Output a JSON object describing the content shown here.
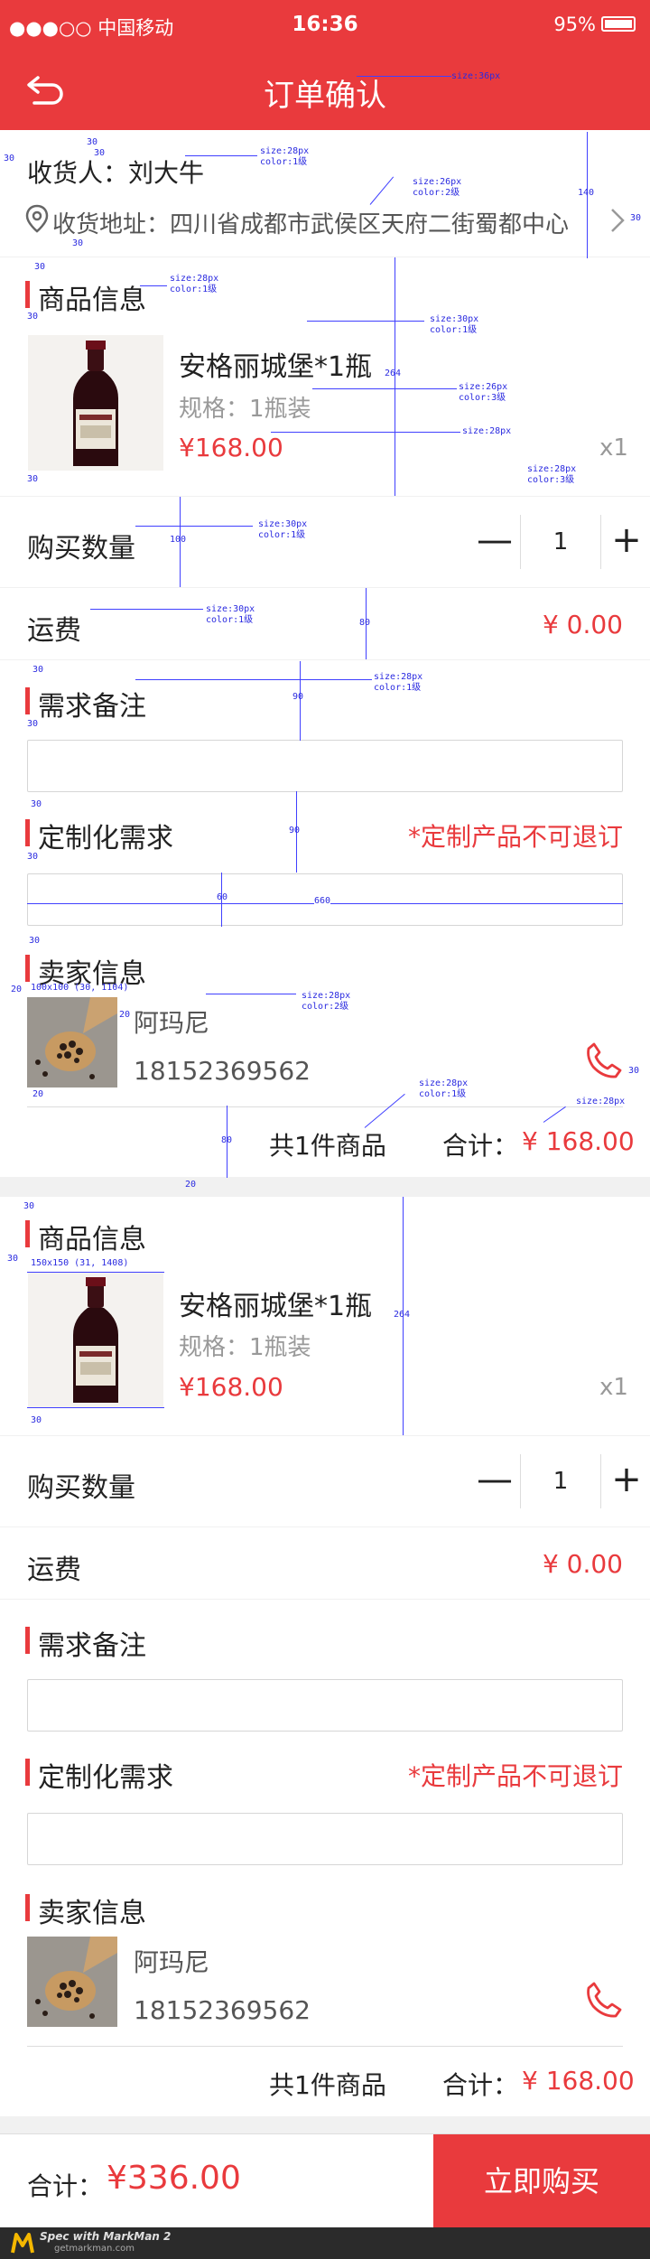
{
  "status": {
    "carrier": "●●●○○ 中国移动",
    "time": "16:36",
    "battery": "95%"
  },
  "nav": {
    "title": "订单确认"
  },
  "address": {
    "receiver": "收货人：刘大牛",
    "address": "收货地址：四川省成都市武侯区天府二街蜀都中心"
  },
  "order_blocks": [
    {
      "section_product": "商品信息",
      "product_name": "安格丽城堡*1瓶",
      "spec": "规格：1瓶装",
      "price": "¥168.00",
      "qty_label": "x1",
      "buy_count_label": "购买数量",
      "buy_count_value": "1",
      "minus": "—",
      "plus": "+",
      "shipping_label": "运费",
      "shipping_value": "¥ 0.00",
      "remark_title": "需求备注",
      "custom_title": "定制化需求",
      "custom_note": "*定制产品不可退订",
      "seller_title": "卖家信息",
      "seller_name": "阿玛尼",
      "seller_phone": "18152369562",
      "total_items": "共1件商品",
      "total_label": "合计：",
      "total_value": "¥ 168.00"
    },
    {
      "section_product": "商品信息",
      "product_name": "安格丽城堡*1瓶",
      "spec": "规格：1瓶装",
      "price": "¥168.00",
      "qty_label": "x1",
      "buy_count_label": "购买数量",
      "buy_count_value": "1",
      "minus": "—",
      "plus": "+",
      "shipping_label": "运费",
      "shipping_value": "¥ 0.00",
      "remark_title": "需求备注",
      "custom_title": "定制化需求",
      "custom_note": "*定制产品不可退订",
      "seller_title": "卖家信息",
      "seller_name": "阿玛尼",
      "seller_phone": "18152369562",
      "total_items": "共1件商品",
      "total_label": "合计：",
      "total_value": "¥ 168.00"
    }
  ],
  "footer": {
    "total_label": "合计：",
    "total_value": "¥336.00",
    "buy_button": "立即购买"
  },
  "markman": {
    "brand": "Spec with MarkMan 2",
    "site": "getmarkman.com"
  },
  "annotations": {
    "nav_title": "size:36px",
    "receiver": "size:28px color:1级",
    "address": "size:26px color:2级",
    "product_title": "size:28px color:1级",
    "product_name": "size:30px color:1级",
    "spec": "size:26px color:3级",
    "price": "size:28px",
    "qty": "size:28px color:3级",
    "buy_count": "size:30px color:1级",
    "shipping": "size:30px color:1级",
    "remark": "size:28px color:1级",
    "seller_name": "size:28px color:2级",
    "total_items": "size:28px color:1级",
    "total_value": "size:28px",
    "seller_img": "100x100 (30, 1104)",
    "product_img": "150x150 (31, 1408)",
    "d30": "30",
    "d20": "20",
    "d60": "60",
    "d80": "80",
    "d90": "90",
    "d100": "100",
    "d140": "140",
    "d264": "264",
    "d660": "660"
  }
}
